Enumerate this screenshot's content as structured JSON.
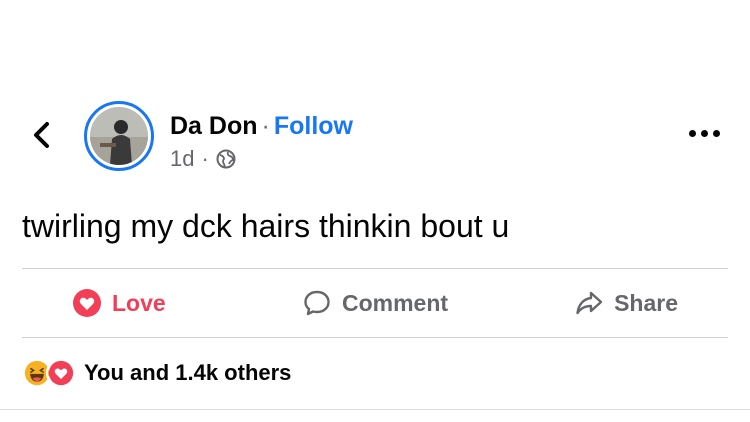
{
  "post": {
    "author_name": "Da Don",
    "separator": "·",
    "follow_label": "Follow",
    "time": "1d",
    "meta_separator": "·",
    "privacy_icon": "globe-icon",
    "text": "twirling my dck hairs thinkin bout u"
  },
  "actions": {
    "love_label": "Love",
    "comment_label": "Comment",
    "share_label": "Share"
  },
  "reactions": {
    "icons": [
      "haha-icon",
      "love-icon"
    ],
    "summary": "You and 1.4k others"
  },
  "colors": {
    "link_blue": "#1877f2",
    "love_red": "#f33e58",
    "secondary_text": "#65676b",
    "divider": "#ced0d4"
  }
}
